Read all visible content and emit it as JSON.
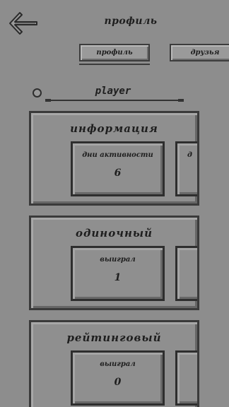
{
  "header": {
    "title": "профиль",
    "tabs": [
      {
        "label": "профиль"
      },
      {
        "label": "друзья"
      }
    ]
  },
  "user": {
    "name": "player"
  },
  "sections": [
    {
      "title": "информация",
      "cards": [
        {
          "label": "дни активности",
          "value": "6"
        },
        {
          "label": "д",
          "value": ""
        }
      ]
    },
    {
      "title": "одиночный",
      "cards": [
        {
          "label": "выиграл",
          "value": "1"
        },
        {
          "label": "",
          "value": ""
        }
      ]
    },
    {
      "title": "рейтинговый",
      "cards": [
        {
          "label": "выиграл",
          "value": "0"
        },
        {
          "label": "",
          "value": ""
        }
      ]
    }
  ],
  "icons": {
    "back": "arrow-left-icon"
  },
  "colors": {
    "background": "#8d8d8d",
    "border": "#3a3a3a",
    "text": "#1e1e1e"
  }
}
